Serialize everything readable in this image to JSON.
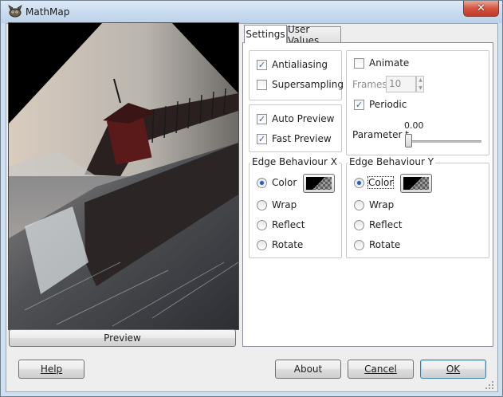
{
  "window": {
    "title": "MathMap",
    "close_glyph": "✕",
    "app_icon": "gimp-icon"
  },
  "preview": {
    "button_label": "Preview"
  },
  "tabs": [
    {
      "label": "Settings",
      "active": true
    },
    {
      "label": "User Values",
      "active": false
    }
  ],
  "settings": {
    "antialiasing": {
      "label": "Antialiasing",
      "checked": true
    },
    "supersampling": {
      "label": "Supersampling",
      "checked": false
    },
    "auto_preview": {
      "label": "Auto Preview",
      "checked": true
    },
    "fast_preview": {
      "label": "Fast Preview",
      "checked": true
    },
    "animate": {
      "label": "Animate",
      "checked": false
    },
    "frames": {
      "label": "Frames",
      "value": "10",
      "enabled": false
    },
    "periodic": {
      "label": "Periodic",
      "checked": true
    },
    "parameter_t": {
      "label": "Parameter t",
      "value": "0.00",
      "fraction": 0.0
    }
  },
  "edge_x": {
    "legend": "Edge Behaviour X",
    "options": [
      "Color",
      "Wrap",
      "Reflect",
      "Rotate"
    ],
    "selected": "Color"
  },
  "edge_y": {
    "legend": "Edge Behaviour Y",
    "options": [
      "Color",
      "Wrap",
      "Reflect",
      "Rotate"
    ],
    "selected": "Color"
  },
  "footer": {
    "help": "Help",
    "about": "About",
    "cancel": "Cancel",
    "ok": "OK"
  },
  "colors": {
    "checkmark": "#4a5f97",
    "radio_dot": "#2a5db0",
    "default_button_border": "#3c7fb1"
  }
}
